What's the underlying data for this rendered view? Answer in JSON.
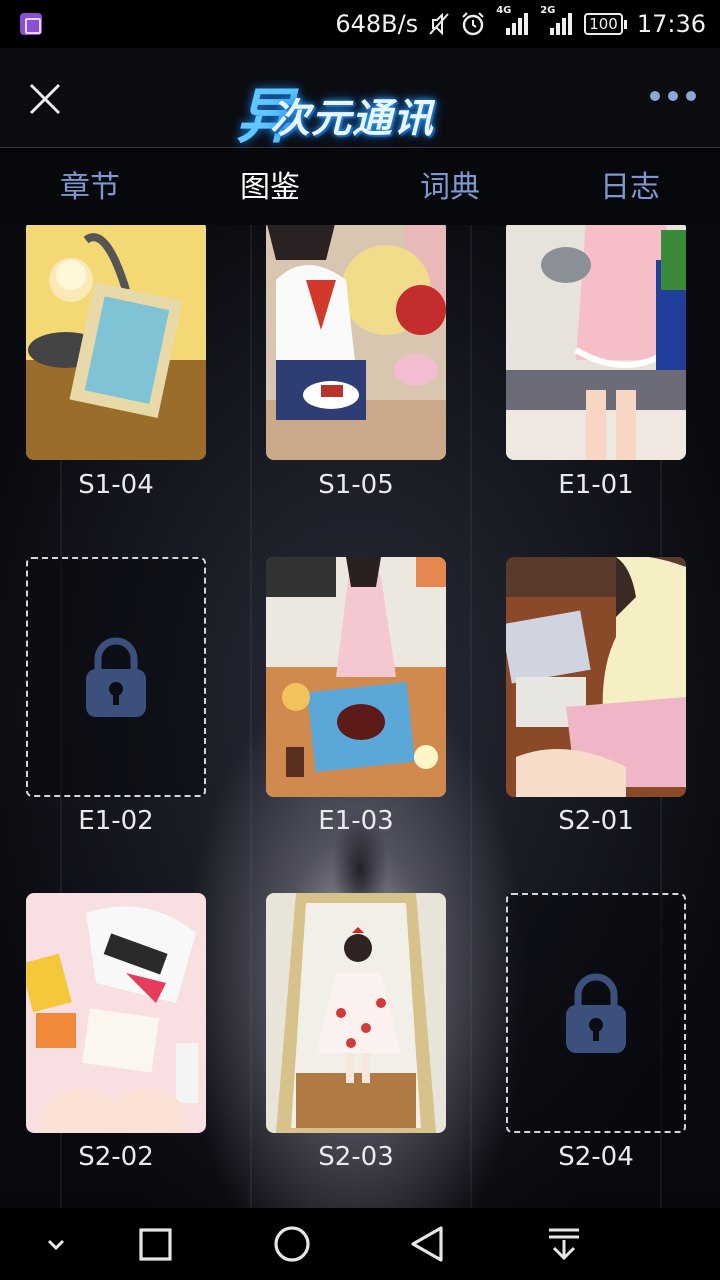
{
  "status_bar": {
    "net_speed": "648B/s",
    "network_a": "4G",
    "network_b": "2G",
    "battery": "100",
    "time": "17:36"
  },
  "header": {
    "logo_mark": "异",
    "logo_text": "次元通讯",
    "close_icon": "close-icon",
    "more_icon": "more-dots-icon"
  },
  "tabs": [
    {
      "label": "章节",
      "active": false
    },
    {
      "label": "图鉴",
      "active": true
    },
    {
      "label": "词典",
      "active": false
    },
    {
      "label": "日志",
      "active": false
    }
  ],
  "gallery": [
    {
      "label": "S1-04",
      "locked": false
    },
    {
      "label": "S1-05",
      "locked": false
    },
    {
      "label": "E1-01",
      "locked": false
    },
    {
      "label": "E1-02",
      "locked": true
    },
    {
      "label": "E1-03",
      "locked": false
    },
    {
      "label": "S2-01",
      "locked": false
    },
    {
      "label": "S2-02",
      "locked": false
    },
    {
      "label": "S2-03",
      "locked": false
    },
    {
      "label": "S2-04",
      "locked": true
    }
  ],
  "nav_bar": [
    "chevron-down-icon",
    "recents-square-icon",
    "home-circle-icon",
    "back-triangle-icon",
    "notification-pull-icon"
  ],
  "colors": {
    "tab_inactive": "#7d97cf",
    "tab_active": "#ffffff",
    "lock": "#3d4f7c"
  }
}
